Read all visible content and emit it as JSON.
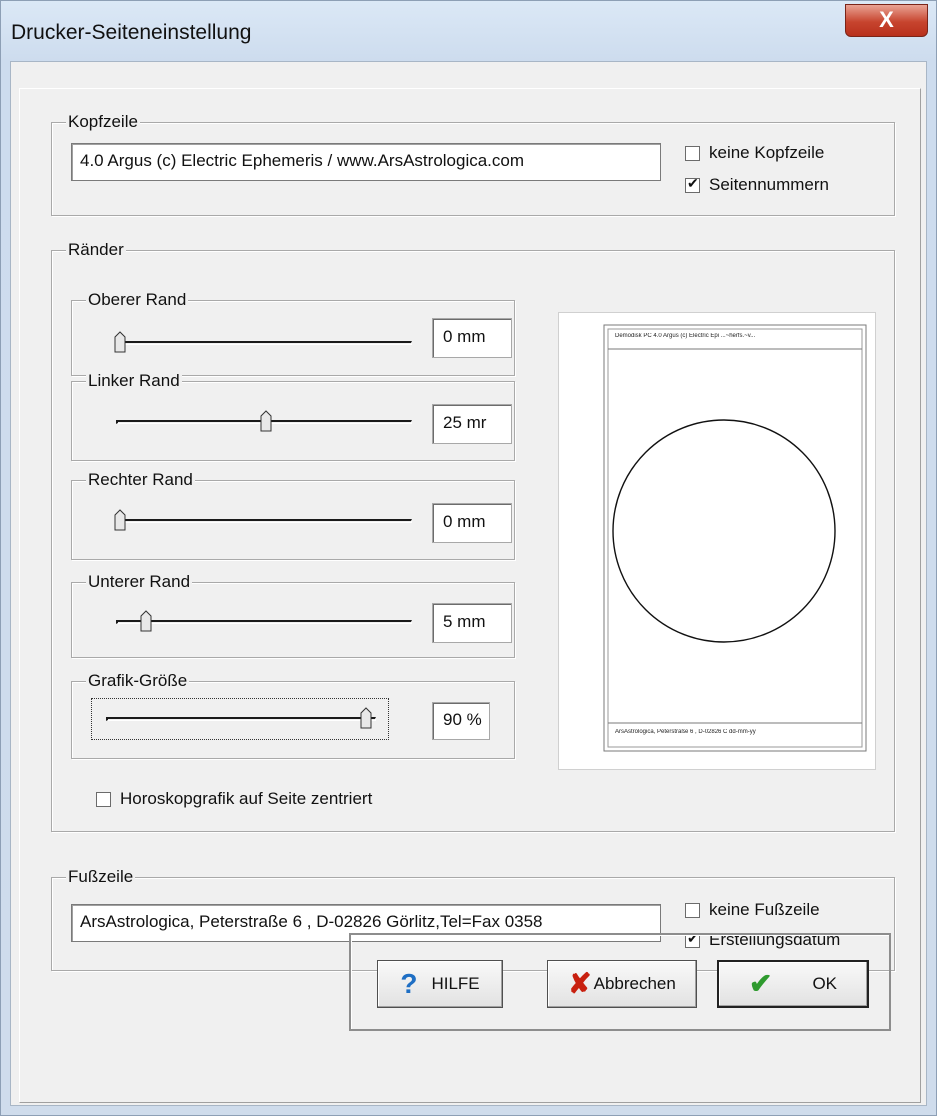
{
  "window": {
    "title": "Drucker-Seiteneinstellung",
    "close_glyph": "X"
  },
  "header": {
    "group_label": "Kopfzeile",
    "text_value": "4.0 Argus (c) Electric Ephemeris / www.ArsAstrologica.com",
    "no_header_label": "keine Kopfzeile",
    "no_header_checked": false,
    "page_numbers_label": "Seitennummern",
    "page_numbers_checked": true
  },
  "margins": {
    "group_label": "Ränder",
    "top": {
      "label": "Oberer Rand",
      "value": "0 mm",
      "position": 0.0
    },
    "left": {
      "label": "Linker Rand",
      "value": "25 mr",
      "position": 0.5
    },
    "right": {
      "label": "Rechter Rand",
      "value": "0 mm",
      "position": 0.0
    },
    "bottom": {
      "label": "Unterer Rand",
      "value": "5 mm",
      "position": 0.1
    },
    "graphic_size": {
      "label": "Grafik-Größe",
      "value": "90 %",
      "position": 0.9
    },
    "center_label": "Horoskopgrafik auf Seite zentriert",
    "center_checked": false
  },
  "preview": {
    "header_text": "Demodisk PC 4.0 Argus (c) Electric Epi ...~herfs.~v...",
    "footer_text": "ArsAstrologica, Peterstraße 6 , D-02826 C  dd-mm-yy"
  },
  "footer": {
    "group_label": "Fußzeile",
    "text_value": "ArsAstrologica, Peterstraße 6 , D-02826 Görlitz,Tel=Fax 0358",
    "no_footer_label": "keine Fußzeile",
    "no_footer_checked": false,
    "creation_date_label": "Erstellungsdatum",
    "creation_date_checked": true
  },
  "buttons": {
    "help_label": "HILFE",
    "cancel_label": "Abbrechen",
    "ok_label": "OK",
    "help_icon_color": "#1f6fc4",
    "cancel_icon_color": "#c8200f",
    "ok_icon_color": "#2e9a2e"
  }
}
